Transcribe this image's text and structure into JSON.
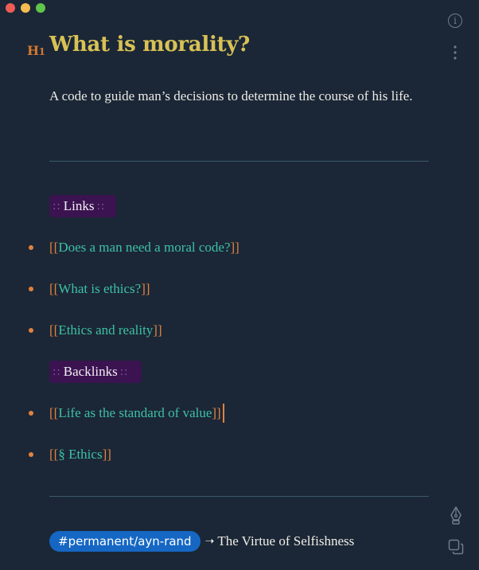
{
  "window": {
    "controls": [
      "close",
      "minimize",
      "zoom"
    ]
  },
  "heading": {
    "marker_letter": "H",
    "marker_level": "1",
    "title": "What is morality?"
  },
  "summary": "A code to guide man’s decisions to determine the course of his life.",
  "links_section": {
    "colons_left": "::",
    "label": "Links",
    "colons_right": "::",
    "items": [
      {
        "open": "[[",
        "text": "Does a man need a moral code?",
        "close": "]]"
      },
      {
        "open": "[[",
        "text": "What is ethics?",
        "close": "]]"
      },
      {
        "open": "[[",
        "text": "Ethics and reality",
        "close": "]]"
      }
    ]
  },
  "backlinks_section": {
    "colons_left": "::",
    "label": "Backlinks",
    "colons_right": "::",
    "items": [
      {
        "open": "[[",
        "text": "Life as the standard of value",
        "close": "]]"
      },
      {
        "open": "[[",
        "text": "§ Ethics",
        "close": "]]"
      }
    ]
  },
  "footer": {
    "hashtag": "#permanent/ayn-rand",
    "arrow": "➝",
    "source": "The Virtue of Selfishness"
  },
  "side_icons": {
    "info": "info-icon",
    "more": "vertical-ellipsis-icon",
    "pen": "fountain-pen-icon",
    "copy": "copy-icon"
  },
  "colors": {
    "background": "#1b2736",
    "title": "#d8c155",
    "heading_marker": "#d4772f",
    "link": "#3ec0a5",
    "bracket": "#e0823f",
    "section_tag_bg": "#3b1350",
    "hashtag_bg": "#1567c3"
  }
}
